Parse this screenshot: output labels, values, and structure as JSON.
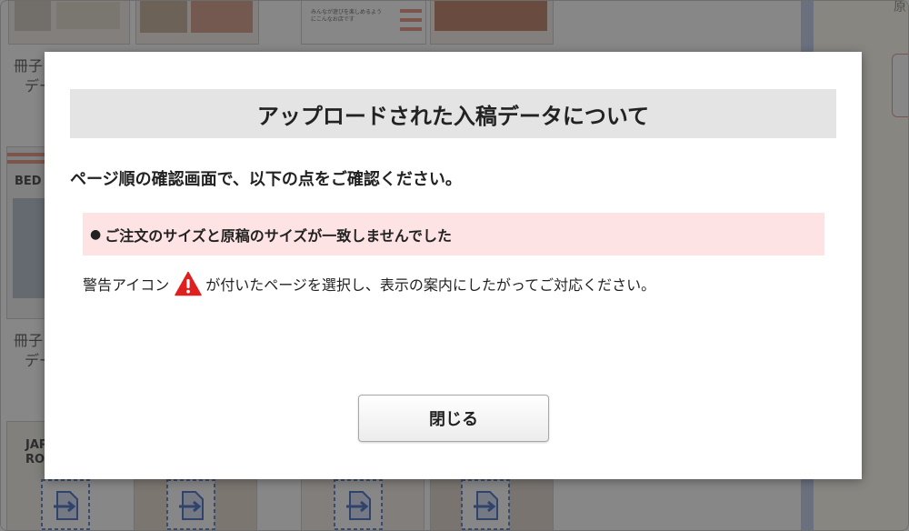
{
  "background": {
    "right_panel_label": "原",
    "thumb_labels": [
      "冊子",
      "デー",
      "冊子",
      "デー"
    ],
    "thumb_texts": [
      "BED",
      "JAP",
      "RO"
    ],
    "thumb_small_text": "みんなが遊びを楽しめるようにこんなお店です"
  },
  "dialog": {
    "title": "アップロードされた入稿データについて",
    "subtitle": "ページ順の確認画面で、以下の点をご確認ください。",
    "warning_bullet": "●",
    "warning_text": "ご注文のサイズと原稿のサイズが一致しませんでした",
    "instruction_before": "警告アイコン",
    "instruction_after": "が付いたページを選択し、表示の案内にしたがってご対応ください。",
    "close_label": "閉じる"
  },
  "colors": {
    "overlay": "#000000",
    "warning_bg": "#fde3e3",
    "header_bg": "#e4e4e4",
    "warning_icon": "#e02020",
    "divider": "#c8d3ee"
  },
  "icons": {
    "warning": "warning-icon",
    "upload": "upload-icon"
  }
}
